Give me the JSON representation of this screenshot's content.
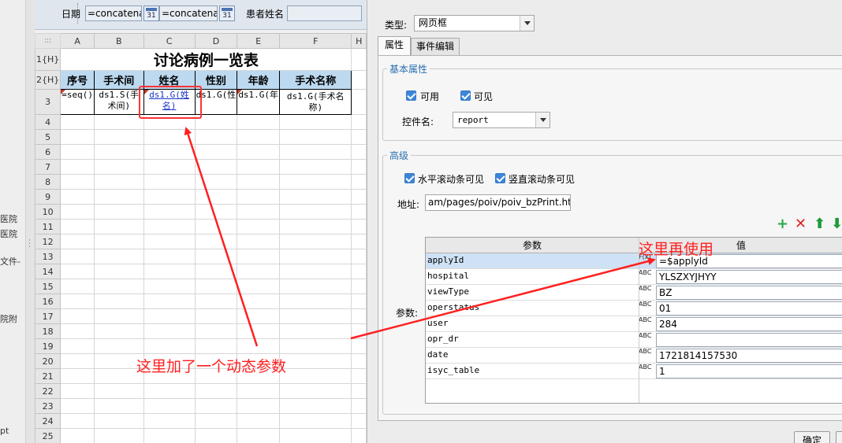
{
  "left_strip": {
    "fragments": [
      "医院",
      "医院",
      "文件-",
      "院附",
      "pt"
    ]
  },
  "param_bar": {
    "date_label": "日期",
    "date_start_value": "=concatena",
    "date_end_value": "=concatenat",
    "calendar_icon_text": "31",
    "patient_label": "患者姓名",
    "patient_value": ""
  },
  "sheet": {
    "columns": [
      "A",
      "B",
      "C",
      "D",
      "E",
      "F",
      "H"
    ],
    "row_labels": [
      "1{H}",
      "2{H}",
      "3",
      "4",
      "5",
      "6",
      "7",
      "8",
      "9",
      "10",
      "11",
      "12",
      "13",
      "14",
      "15",
      "16",
      "17",
      "18",
      "19",
      "20",
      "21",
      "22",
      "23",
      "24",
      "25"
    ],
    "title": "讨论病例一览表",
    "headers": [
      "序号",
      "手术间",
      "姓名",
      "性别",
      "年龄",
      "手术名称"
    ],
    "data_row": [
      "=seq()",
      "ds1.S(手术间)",
      "ds1.G(姓名)",
      "ds1.G(性",
      "ds1.G(年",
      "ds1.G(手术名称)"
    ]
  },
  "dialog": {
    "type_label": "类型:",
    "type_value": "网页框",
    "tabs": [
      "属性",
      "事件编辑"
    ],
    "basic_title": "基本属性",
    "enabled_label": "可用",
    "visible_label": "可见",
    "control_name_label": "控件名:",
    "control_name_value": "report",
    "advanced_title": "高级",
    "hscroll_label": "水平滚动条可见",
    "vscroll_label": "竖直滚动条可见",
    "address_label": "地址:",
    "address_value": "am/pages/poiv/poiv_bzPrint.html",
    "params_label": "参数:",
    "param_col_header": "参数",
    "value_col_header": "值",
    "params": [
      {
        "name": "applyId",
        "type": "F(x)",
        "value": "=$applyId",
        "selected": true
      },
      {
        "name": "hospital",
        "type": "ABC",
        "value": "YLSZXYJHYY",
        "selected": false
      },
      {
        "name": "viewType",
        "type": "ABC",
        "value": "BZ",
        "selected": false
      },
      {
        "name": "operstatus",
        "type": "ABC",
        "value": "01",
        "selected": false
      },
      {
        "name": "user",
        "type": "ABC",
        "value": "284",
        "selected": false
      },
      {
        "name": "opr_dr",
        "type": "ABC",
        "value": "",
        "selected": false
      },
      {
        "name": "date",
        "type": "ABC",
        "value": "1721814157530",
        "selected": false
      },
      {
        "name": "isyc_table",
        "type": "ABC",
        "value": "1",
        "selected": false
      }
    ],
    "ok_button": "确定"
  },
  "annotations": {
    "left_note": "这里加了一个动态参数",
    "right_note": "这里再使用",
    "color": "#ff2020"
  }
}
